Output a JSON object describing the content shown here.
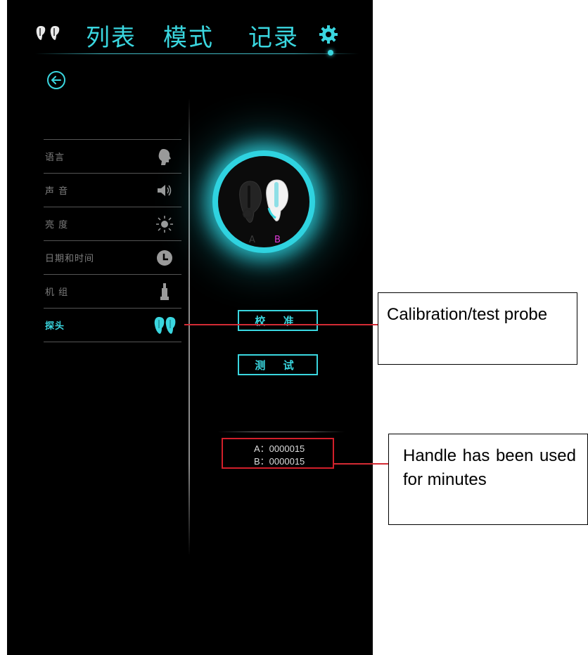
{
  "nav": {
    "tabs": [
      "列表",
      "模式",
      "记录"
    ],
    "icons": [
      "earphones-icon",
      "gear-icon"
    ]
  },
  "menu": {
    "items": [
      {
        "label": "语言",
        "icon": "head-icon"
      },
      {
        "label": "声 音",
        "icon": "speaker-icon"
      },
      {
        "label": "亮 度",
        "icon": "sun-icon"
      },
      {
        "label": "日期和时间",
        "icon": "clock-icon"
      },
      {
        "label": "机 组",
        "icon": "unit-icon"
      },
      {
        "label": "探头",
        "icon": "probe-icon",
        "active": true
      }
    ]
  },
  "probe": {
    "label_a": "A",
    "label_b": "B"
  },
  "buttons": {
    "calibrate": "校 准",
    "test": "测 试"
  },
  "counters": {
    "a": "A：0000015",
    "b": "B：0000015"
  },
  "annotations": {
    "calibration": "Calibration/test probe",
    "handle": "Handle has been used for minutes"
  },
  "colors": {
    "accent": "#3ad6df",
    "annotation_red": "#d32b34",
    "probe_b": "#e03ad8"
  }
}
